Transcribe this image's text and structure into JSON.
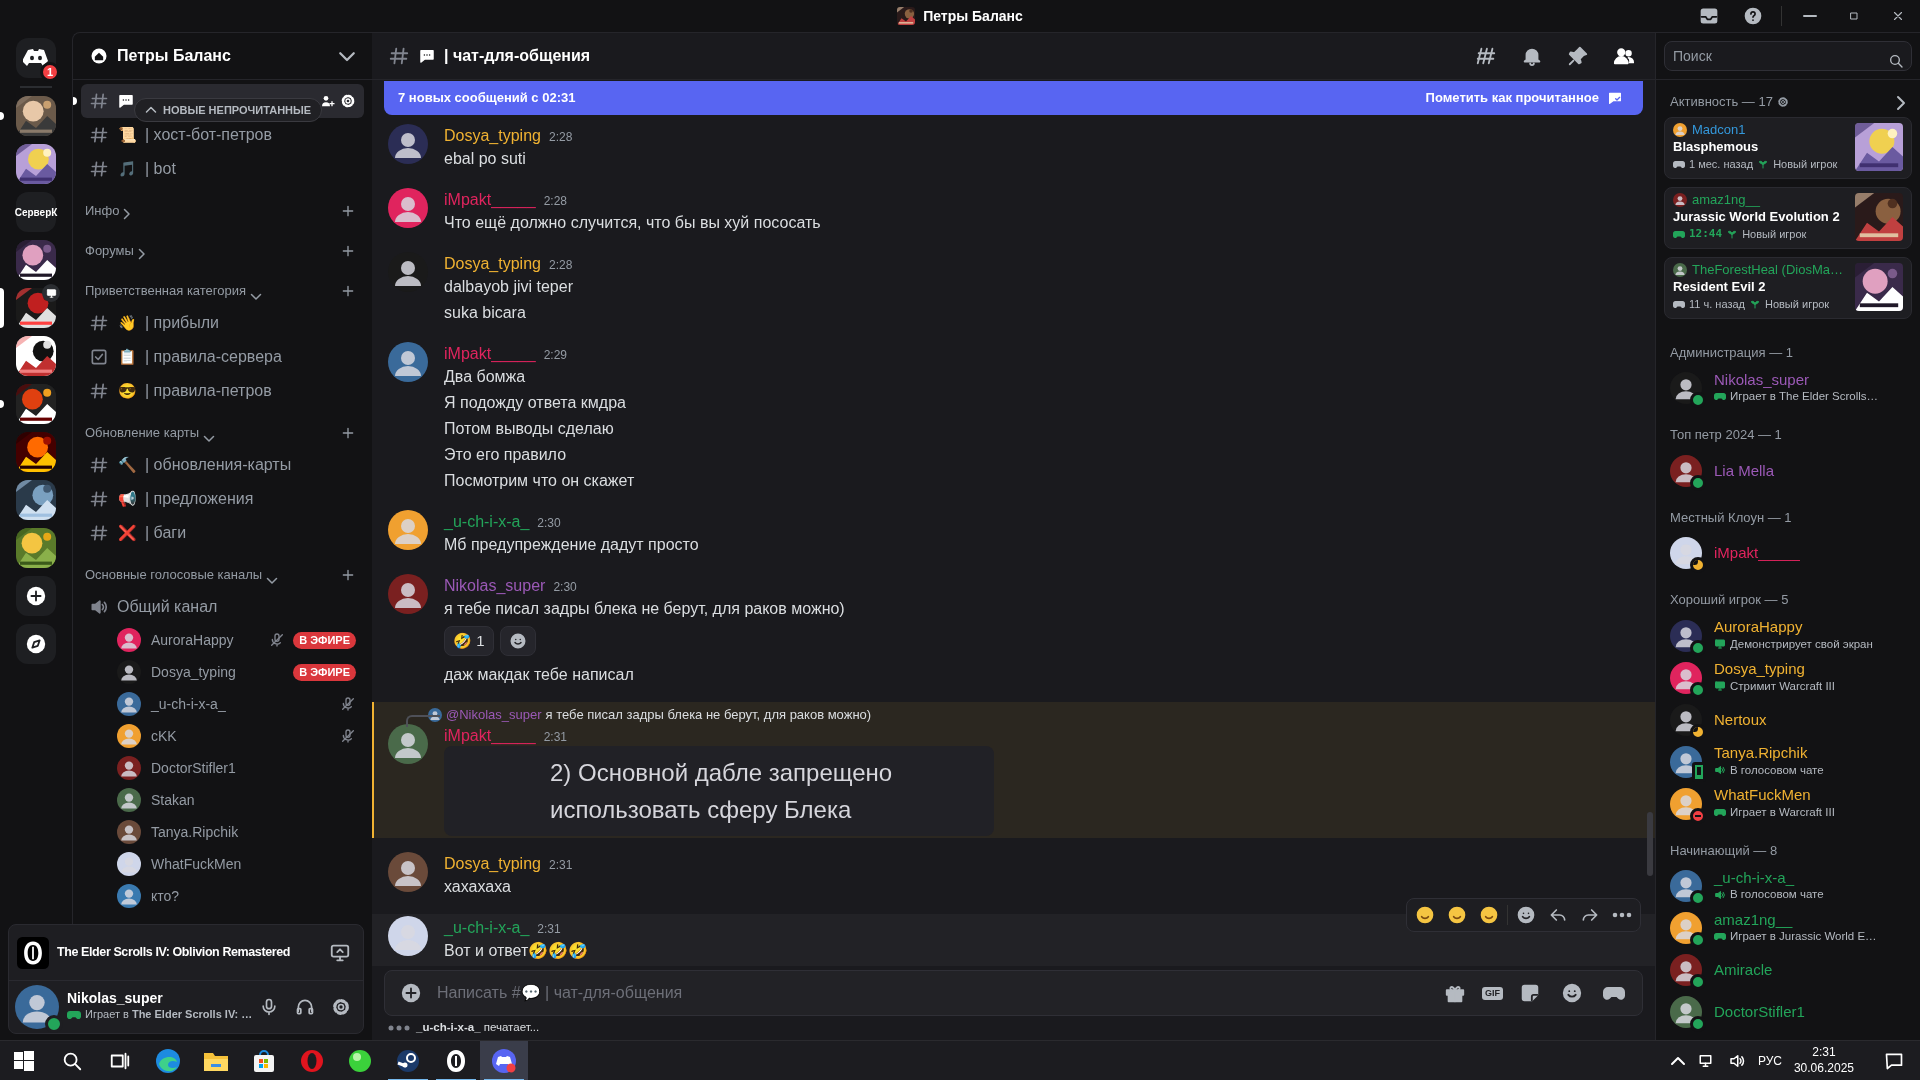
{
  "window": {
    "title": "Петры Баланс"
  },
  "servers": [
    {
      "kind": "home",
      "badge": "1",
      "selected": false,
      "unread": false,
      "live": false
    },
    {
      "kind": "picture",
      "selected": false,
      "unread": true,
      "live": false
    },
    {
      "kind": "picture",
      "selected": false,
      "unread": false,
      "live": false
    },
    {
      "kind": "text",
      "label": "СерверК",
      "selected": false,
      "unread": false,
      "live": false
    },
    {
      "kind": "picture",
      "selected": false,
      "unread": false,
      "live": false
    },
    {
      "kind": "picture",
      "selected": true,
      "unread": false,
      "live": true
    },
    {
      "kind": "picture",
      "selected": false,
      "unread": false,
      "live": false
    },
    {
      "kind": "picture",
      "selected": false,
      "unread": true,
      "live": false
    },
    {
      "kind": "picture",
      "selected": false,
      "unread": false,
      "live": false
    },
    {
      "kind": "picture",
      "selected": false,
      "unread": false,
      "live": false
    },
    {
      "kind": "picture",
      "selected": false,
      "unread": false,
      "live": false
    },
    {
      "kind": "add",
      "selected": false,
      "unread": false,
      "live": false
    },
    {
      "kind": "discover",
      "selected": false,
      "unread": false,
      "live": false
    }
  ],
  "sidebar": {
    "server_name": "Петры Баланс",
    "unread_pill": "НОВЫЕ НЕПРОЧИТАННЫЕ",
    "items": [
      {
        "kind": "text-channel",
        "selected": true,
        "unread": true
      },
      {
        "kind": "text-channel",
        "emoji": "📜",
        "name": "| хост-бот-петров",
        "selected": false,
        "unread": false
      },
      {
        "kind": "text-channel",
        "emoji": "🎵",
        "name": "| bot",
        "selected": false,
        "unread": false
      },
      {
        "kind": "category",
        "label": "Инфо",
        "expanded": false
      },
      {
        "kind": "category",
        "label": "Форумы",
        "expanded": false
      },
      {
        "kind": "category",
        "label": "Приветственная категория",
        "expanded": true
      },
      {
        "kind": "text-channel",
        "emoji": "👋",
        "name": "| прибыли",
        "selected": false,
        "unread": false
      },
      {
        "kind": "rules-channel",
        "emoji": "📋",
        "name": "| правила-сервера",
        "selected": false,
        "unread": false
      },
      {
        "kind": "text-channel",
        "emoji": "😎",
        "name": "| правила-петров",
        "selected": false,
        "unread": false
      },
      {
        "kind": "category",
        "label": "Обновление карты",
        "expanded": true
      },
      {
        "kind": "text-channel",
        "emoji": "🔨",
        "name": "| обновления-карты",
        "selected": false,
        "unread": false
      },
      {
        "kind": "text-channel",
        "emoji": "📢",
        "name": "| предложения",
        "selected": false,
        "unread": false
      },
      {
        "kind": "text-channel",
        "emoji": "❌",
        "name": "| баги",
        "selected": false,
        "unread": false
      },
      {
        "kind": "category",
        "label": "Основные голосовые каналы",
        "expanded": true
      },
      {
        "kind": "voice-channel",
        "name": "Общий канал",
        "members": [
          {
            "name": "AuroraHappy",
            "muted": true,
            "badge": "В ЭФИРЕ"
          },
          {
            "name": "Dosya_typing",
            "muted": false,
            "badge": "В ЭФИРЕ"
          },
          {
            "name": "_u-ch-i-x-a_",
            "muted": true
          },
          {
            "name": "cKK",
            "muted": true
          },
          {
            "name": "DoctorStifler1",
            "muted": false
          },
          {
            "name": "Stakan",
            "muted": false
          },
          {
            "name": "Tanya.Ripchik",
            "muted": false
          },
          {
            "name": "WhatFuckMen",
            "muted": false
          },
          {
            "name": "кто?",
            "muted": false
          }
        ]
      }
    ]
  },
  "activity_panel": {
    "game": "The Elder Scrolls IV: Oblivion Remastered"
  },
  "user_panel": {
    "name": "Nikolas_super",
    "status": "Играет в **The Elder Scrolls IV: …**",
    "presence": {
      "kind": "dot",
      "color": "#23a55a"
    }
  },
  "chat": {
    "channel_name": "| чат-для-общения",
    "banner": {
      "text": "7 новых сообщений с 02:31",
      "action": "Пометить как прочитанное"
    },
    "messages": [
      {
        "author": "Dosya_typing",
        "color": "#f0b232",
        "time": "2:28",
        "highlighted": false,
        "hovered": false,
        "rows": [
          {
            "kind": "text",
            "text": "ebal po suti"
          }
        ]
      },
      {
        "author": "iMpakt_____",
        "color": "#e0245e",
        "time": "2:28",
        "highlighted": false,
        "hovered": false,
        "rows": [
          {
            "kind": "text",
            "text": "Что ещё должно случится, что бы вы хуй пососать"
          }
        ]
      },
      {
        "author": "Dosya_typing",
        "color": "#f0b232",
        "time": "2:28",
        "highlighted": false,
        "hovered": false,
        "rows": [
          {
            "kind": "text",
            "text": "dalbayob jivi teper"
          },
          {
            "kind": "text",
            "text": "suka bicara"
          }
        ]
      },
      {
        "author": "iMpakt_____",
        "color": "#e0245e",
        "time": "2:29",
        "highlighted": false,
        "hovered": false,
        "rows": [
          {
            "kind": "text",
            "text": "Два бомжа"
          },
          {
            "kind": "text",
            "text": "Я подожду ответа кмдра"
          },
          {
            "kind": "text",
            "text": "Потом выводы сделаю"
          },
          {
            "kind": "text",
            "text": "Это его правило"
          },
          {
            "kind": "text",
            "text": "Посмотрим что он скажет"
          }
        ]
      },
      {
        "author": "_u-ch-i-x-a_",
        "color": "#23a55a",
        "time": "2:30",
        "highlighted": false,
        "hovered": false,
        "rows": [
          {
            "kind": "text",
            "text": "Мб предупреждение дадут просто"
          }
        ]
      },
      {
        "author": "Nikolas_super",
        "color": "#9b59b6",
        "time": "2:30",
        "highlighted": false,
        "hovered": false,
        "rows": [
          {
            "kind": "text",
            "text": "я тебе писал задры блека не берут, для раков можно)"
          },
          {
            "kind": "reactions",
            "reactions": [
              {
                "emoji": "🤣",
                "count": "1"
              }
            ]
          },
          {
            "kind": "text",
            "text": "даж макдак тебе написал"
          }
        ]
      },
      {
        "author": "iMpakt_____",
        "color": "#e0245e",
        "time": "2:31",
        "highlighted": true,
        "hovered": false,
        "reply": {
          "author": "@Nikolas_super",
          "text": "я тебе писал задры блека не берут, для раков можно)"
        },
        "rows": [
          {
            "lines": [
              "2) Основной дабле запрещено",
              "использовать сферу Блека"
            ]
          }
        ]
      },
      {
        "author": "Dosya_typing",
        "color": "#f0b232",
        "time": "2:31",
        "highlighted": false,
        "hovered": false,
        "rows": [
          {
            "kind": "text",
            "text": "хахахаха"
          }
        ]
      },
      {
        "author": "_u-ch-i-x-a_",
        "color": "#23a55a",
        "time": "2:31",
        "highlighted": false,
        "hovered": true,
        "rows": [
          {
            "kind": "text",
            "text": "Вот и ответ🤣🤣🤣"
          }
        ]
      }
    ],
    "input": {
      "placeholder": "Написать #💬 | чат-для-общения",
      "gif": "GIF"
    },
    "typing": "**_u-ch-i-x-a_** печатает..."
  },
  "members": {
    "search": {
      "placeholder": "Поиск"
    },
    "activity_title": "Активность — 17",
    "activity_cards": [
      {
        "user": "Madcon1",
        "color": "#3498db",
        "game": "Blasphemous",
        "time": "1 мес. назад",
        "live": false,
        "tag": "Новый игрок"
      },
      {
        "user": "amaz1ng__",
        "color": "#23a55a",
        "game": "Jurassic World Evolution 2",
        "time": "12:44",
        "live": true,
        "tag": "Новый игрок"
      },
      {
        "user": "TheForestHeal (DiosMa…",
        "color": "#23a55a",
        "game": "Resident Evil 2",
        "time": "11 ч. назад",
        "live": false,
        "tag": "Новый игрок"
      }
    ],
    "groups": [
      {
        "title": "Администрация — 1",
        "members": [
          {
            "name": "Nikolas_super",
            "color": "#9b59b6",
            "presence": {
              "kind": "dot",
              "color": "#23a55a"
            },
            "kind": "game",
            "status": "Играет в The Elder Scrolls…"
          }
        ]
      },
      {
        "title": "Топ петр 2024 — 1",
        "members": [
          {
            "name": "Lia Mella",
            "color": "#9b59b6",
            "presence": {
              "kind": "dot",
              "color": "#23a55a"
            }
          }
        ]
      },
      {
        "title": "Местный Клоун — 1",
        "members": [
          {
            "name": "iMpakt_____",
            "color": "#e0245e",
            "presence": {
              "kind": "moon",
              "color": "#f0b232"
            }
          }
        ]
      },
      {
        "title": "Хороший игрок — 5",
        "members": [
          {
            "name": "AuroraHappy",
            "color": "#f0b232",
            "presence": {
              "kind": "dot",
              "color": "#23a55a"
            },
            "kind": "screen",
            "status": "Демонстрирует свой экран"
          },
          {
            "name": "Dosya_typing",
            "color": "#f0b232",
            "presence": {
              "kind": "dot",
              "color": "#23a55a"
            },
            "kind": "screen",
            "status": "Стримит Warcraft III"
          },
          {
            "name": "Nertoux",
            "color": "#f0b232",
            "presence": {
              "kind": "moon",
              "color": "#f0b232"
            }
          },
          {
            "name": "Tanya.Ripchik",
            "color": "#f0b232",
            "presence": {
              "kind": "phone",
              "color": "#23a55a"
            },
            "kind": "voice",
            "status": "В голосовом чате"
          },
          {
            "name": "WhatFuckMen",
            "color": "#f0b232",
            "presence": {
              "kind": "dnd",
              "color": "#f23f43"
            },
            "kind": "game",
            "status": "Играет в Warcraft III"
          }
        ]
      },
      {
        "title": "Начинающий — 8",
        "members": [
          {
            "name": "_u-ch-i-x-a_",
            "color": "#23a55a",
            "presence": {
              "kind": "dot",
              "color": "#23a55a"
            },
            "kind": "voice",
            "status": "В голосовом чате"
          },
          {
            "name": "amaz1ng__",
            "color": "#23a55a",
            "presence": {
              "kind": "dot",
              "color": "#23a55a"
            },
            "kind": "game",
            "status": "Играет в Jurassic World E…"
          },
          {
            "name": "Amiracle",
            "color": "#23a55a",
            "presence": {
              "kind": "dot",
              "color": "#23a55a"
            }
          },
          {
            "name": "DoctorStifler1",
            "color": "#23a55a",
            "presence": {
              "kind": "dot",
              "color": "#23a55a"
            }
          }
        ]
      }
    ]
  },
  "taskbar": {
    "apps": [
      {
        "running": false,
        "selected": false
      },
      {
        "running": false,
        "selected": false
      },
      {
        "running": false,
        "selected": false
      },
      {
        "running": false,
        "selected": false
      },
      {
        "running": false,
        "selected": false
      },
      {
        "running": false,
        "selected": false
      },
      {
        "running": false,
        "selected": false
      },
      {
        "running": false,
        "selected": false
      },
      {
        "running": true,
        "selected": false
      },
      {
        "running": true,
        "selected": false
      },
      {
        "running": true,
        "selected": true
      }
    ],
    "language": "РУС",
    "time": "2:31",
    "date": "30.06.2025"
  }
}
